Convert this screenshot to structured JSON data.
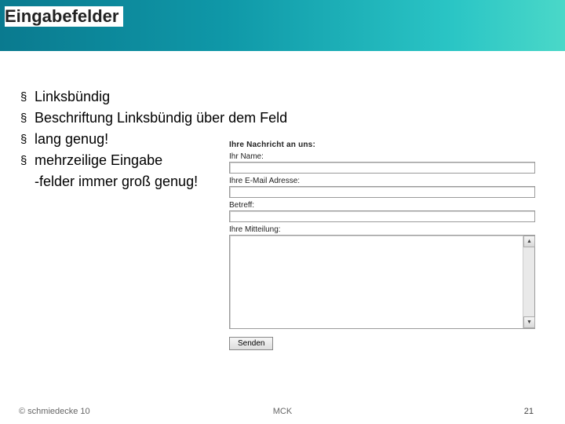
{
  "header": {
    "title": "Eingabefelder"
  },
  "bullets": [
    "Linksbündig",
    "Beschriftung Linksbündig über dem Feld",
    "lang genug!",
    "mehrzeilige Eingabe\n-felder immer groß genug!"
  ],
  "form": {
    "heading": "Ihre Nachricht an uns:",
    "name_label": "Ihr Name:",
    "email_label": "Ihre E-Mail Adresse:",
    "subject_label": "Betreff:",
    "message_label": "Ihre Mitteilung:",
    "send_label": "Senden"
  },
  "footer": {
    "left": "© schmiedecke 10",
    "center": "MCK",
    "right": "21"
  }
}
